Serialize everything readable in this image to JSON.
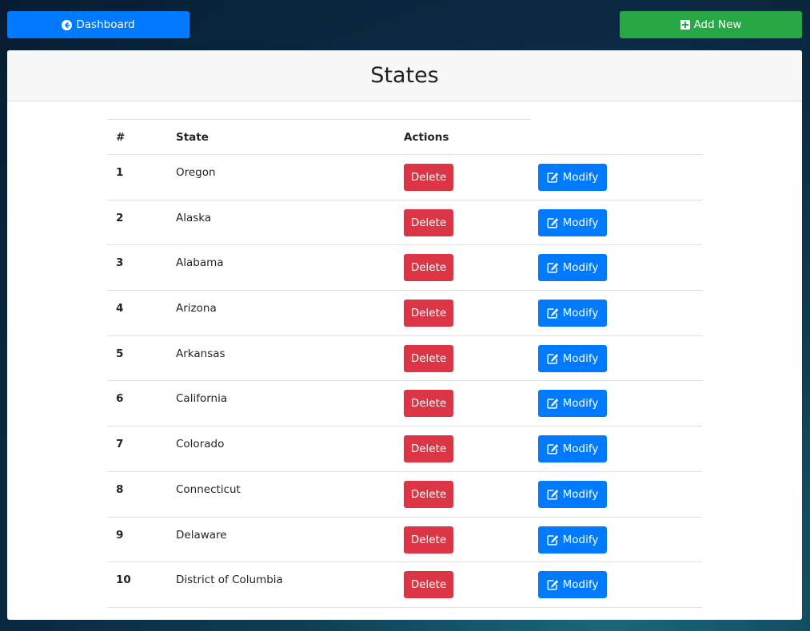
{
  "header": {
    "dashboard_label": "Dashboard",
    "add_new_label": "Add New"
  },
  "card": {
    "title": "States"
  },
  "table": {
    "columns": [
      "#",
      "State",
      "Actions"
    ],
    "delete_label": "Delete",
    "modify_label": "Modify",
    "rows": [
      {
        "num": "1",
        "state": "Oregon"
      },
      {
        "num": "2",
        "state": "Alaska"
      },
      {
        "num": "3",
        "state": "Alabama"
      },
      {
        "num": "4",
        "state": "Arizona"
      },
      {
        "num": "5",
        "state": "Arkansas"
      },
      {
        "num": "6",
        "state": "California"
      },
      {
        "num": "7",
        "state": "Colorado"
      },
      {
        "num": "8",
        "state": "Connecticut"
      },
      {
        "num": "9",
        "state": "Delaware"
      },
      {
        "num": "10",
        "state": "District of Columbia"
      }
    ]
  },
  "icons": {
    "dashboard": "arrow-circle-left-icon",
    "add_new": "plus-square-icon",
    "modify": "edit-icon"
  },
  "colors": {
    "primary": "#007bff",
    "success": "#28a745",
    "danger": "#dc3545"
  }
}
